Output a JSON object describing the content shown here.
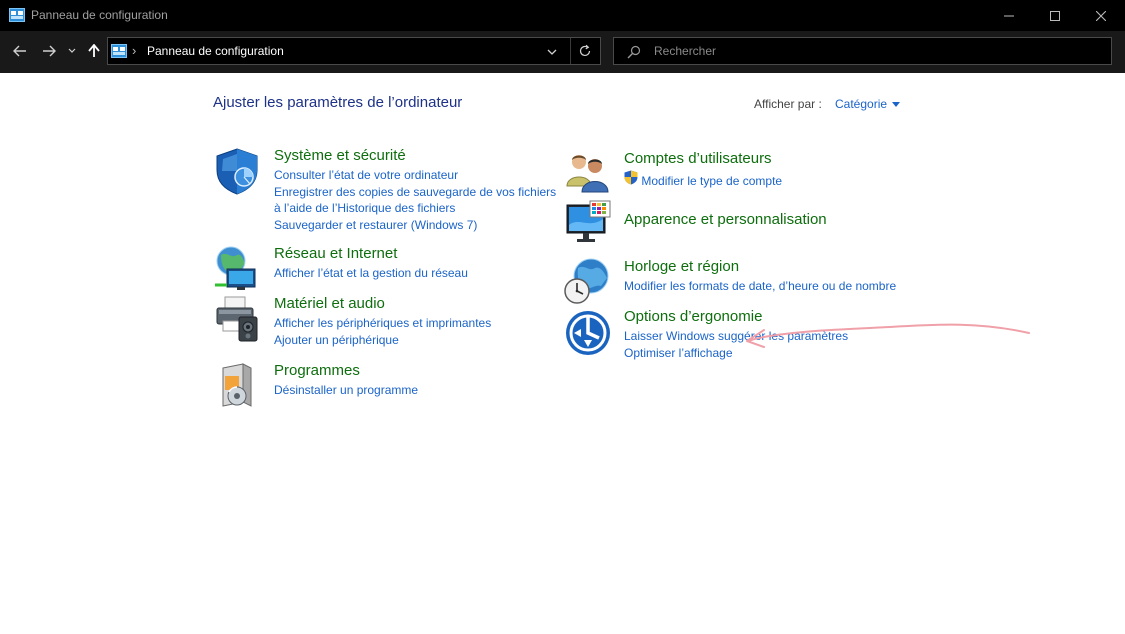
{
  "window": {
    "title": "Panneau de configuration"
  },
  "address_bar": {
    "path": "Panneau de configuration"
  },
  "search": {
    "placeholder": "Rechercher"
  },
  "main": {
    "page_title": "Ajuster les paramètres de l’ordinateur",
    "view_by_label": "Afficher par :",
    "view_by_value": "Catégorie"
  },
  "categories": [
    {
      "title": "Système et sécurité",
      "icon": "shield-icon",
      "links": [
        "Consulter l’état de votre ordinateur",
        "Enregistrer des copies de sauvegarde de vos fichiers à l’aide de l’Historique des fichiers",
        "Sauvegarder et restaurer (Windows 7)"
      ]
    },
    {
      "title": "Réseau et Internet",
      "icon": "network-icon",
      "links": [
        "Afficher l’état et la gestion du réseau"
      ]
    },
    {
      "title": "Matériel et audio",
      "icon": "printer-icon",
      "links": [
        "Afficher les périphériques et imprimantes",
        "Ajouter un périphérique"
      ]
    },
    {
      "title": "Programmes",
      "icon": "programs-icon",
      "links": [
        "Désinstaller un programme"
      ]
    },
    {
      "title": "Comptes d’utilisateurs",
      "icon": "users-icon",
      "links": [
        "Modifier le type de compte"
      ]
    },
    {
      "title": "Apparence et personnalisation",
      "icon": "monitor-palette-icon",
      "links": []
    },
    {
      "title": "Horloge et région",
      "icon": "clock-globe-icon",
      "links": [
        "Modifier les formats de date, d’heure ou de nombre"
      ]
    },
    {
      "title": "Options d’ergonomie",
      "icon": "ease-of-access-icon",
      "links": [
        "Laisser Windows suggérer les paramètres",
        "Optimiser l’affichage"
      ]
    }
  ],
  "colors": {
    "titlebar_bg": "#000000",
    "navbar_bg": "#191919",
    "link_blue": "#1b64c8",
    "category_green": "#0e6e0e",
    "title_blue": "#1e3287",
    "annotation_pink": "#f0a0a8"
  }
}
